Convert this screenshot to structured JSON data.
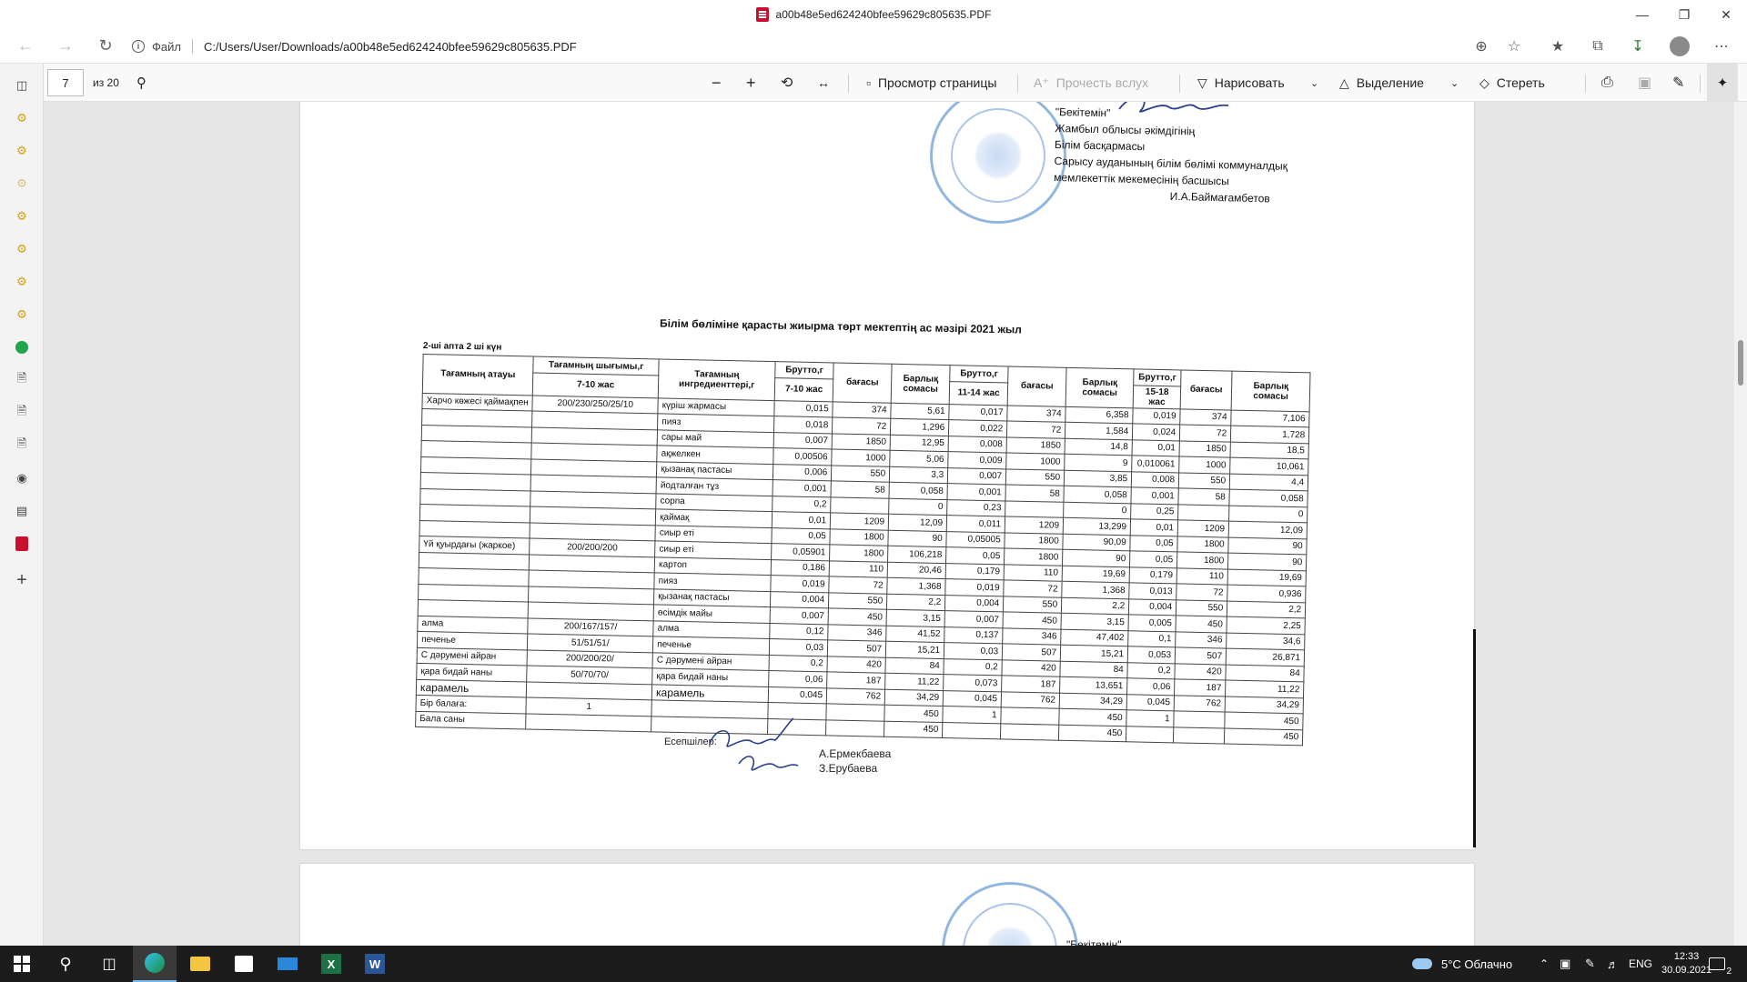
{
  "window": {
    "title": "a00b48e5ed624240bfee59629c805635.PDF"
  },
  "address": {
    "scheme_label": "Файл",
    "url": "C:/Users/User/Downloads/a00b48e5ed624240bfee59629c805635.PDF"
  },
  "pdf_toolbar": {
    "page_current": "7",
    "page_total": "из 20",
    "page_view": "Просмотр страницы",
    "read_aloud": "Прочесть вслух",
    "draw": "Нарисовать",
    "highlight": "Выделение",
    "erase": "Стереть"
  },
  "document": {
    "approval": {
      "heading": "\"Бекітемін\"",
      "line1": "Жамбыл облысы  әкімдігінің",
      "line2": "Білім басқармасы",
      "line3": "Сарысу ауданының білім бөлімі коммуналдық",
      "line4": "мемлекеттік мекемесінің басшысы",
      "signer": "И.А.Баймағамбетов"
    },
    "title": "Білім бөліміне қарасты жиырма төрт мектептің ас мәзірі 2021 жыл",
    "week": "2-ші апта 2 ші күн",
    "headers": {
      "food_name": "Тағамның атауы",
      "yield": "Тағамның шығымы,г",
      "ingredients": "Тағамның ингредиенттері,г",
      "brutto": "Брутто,г",
      "price": "бағасы",
      "total": "Барлық сомасы",
      "age1": "7-10 жас",
      "age2": "11-14 жас",
      "age3": "15-18 жас",
      "total_last": "Барлық сомасы"
    },
    "rows": [
      {
        "dish": "Харчо көжесі қаймақпен",
        "yield": "200/230/250/25/10",
        "ing": "күріш жармасы",
        "c": [
          "0,015",
          "374",
          "5,61",
          "0,017",
          "374",
          "6,358",
          "0,019",
          "374",
          "7,106"
        ]
      },
      {
        "dish": "",
        "yield": "",
        "ing": "пияз",
        "c": [
          "0,018",
          "72",
          "1,296",
          "0,022",
          "72",
          "1,584",
          "0,024",
          "72",
          "1,728"
        ]
      },
      {
        "dish": "",
        "yield": "",
        "ing": "сары май",
        "c": [
          "0,007",
          "1850",
          "12,95",
          "0,008",
          "1850",
          "14,8",
          "0,01",
          "1850",
          "18,5"
        ]
      },
      {
        "dish": "",
        "yield": "",
        "ing": "ақжелкен",
        "c": [
          "0,00506",
          "1000",
          "5,06",
          "0,009",
          "1000",
          "9",
          "0,010061",
          "1000",
          "10,061"
        ]
      },
      {
        "dish": "",
        "yield": "",
        "ing": "қызанақ пастасы",
        "c": [
          "0,006",
          "550",
          "3,3",
          "0,007",
          "550",
          "3,85",
          "0,008",
          "550",
          "4,4"
        ]
      },
      {
        "dish": "",
        "yield": "",
        "ing": "йодталған тұз",
        "c": [
          "0,001",
          "58",
          "0,058",
          "0,001",
          "58",
          "0,058",
          "0,001",
          "58",
          "0,058"
        ]
      },
      {
        "dish": "",
        "yield": "",
        "ing": "сорпа",
        "c": [
          "0,2",
          "",
          "0",
          "0,23",
          "",
          "0",
          "0,25",
          "",
          "0"
        ]
      },
      {
        "dish": "",
        "yield": "",
        "ing": "қаймақ",
        "c": [
          "0,01",
          "1209",
          "12,09",
          "0,011",
          "1209",
          "13,299",
          "0,01",
          "1209",
          "12,09"
        ]
      },
      {
        "dish": "",
        "yield": "",
        "ing": "сиыр еті",
        "c": [
          "0,05",
          "1800",
          "90",
          "0,05005",
          "1800",
          "90,09",
          "0,05",
          "1800",
          "90"
        ]
      },
      {
        "dish": "Үй қуырдағы (жаркое)",
        "yield": "200/200/200",
        "ing": "сиыр еті",
        "c": [
          "0,05901",
          "1800",
          "106,218",
          "0,05",
          "1800",
          "90",
          "0,05",
          "1800",
          "90"
        ]
      },
      {
        "dish": "",
        "yield": "",
        "ing": "картоп",
        "c": [
          "0,186",
          "110",
          "20,46",
          "0,179",
          "110",
          "19,69",
          "0,179",
          "110",
          "19,69"
        ]
      },
      {
        "dish": "",
        "yield": "",
        "ing": "пияз",
        "c": [
          "0,019",
          "72",
          "1,368",
          "0,019",
          "72",
          "1,368",
          "0,013",
          "72",
          "0,936"
        ]
      },
      {
        "dish": "",
        "yield": "",
        "ing": "қызанақ пастасы",
        "c": [
          "0,004",
          "550",
          "2,2",
          "0,004",
          "550",
          "2,2",
          "0,004",
          "550",
          "2,2"
        ]
      },
      {
        "dish": "",
        "yield": "",
        "ing": "өсімдік майы",
        "c": [
          "0,007",
          "450",
          "3,15",
          "0,007",
          "450",
          "3,15",
          "0,005",
          "450",
          "2,25"
        ]
      },
      {
        "dish": "алма",
        "yield": "200/167/157/",
        "ing": "алма",
        "c": [
          "0,12",
          "346",
          "41,52",
          "0,137",
          "346",
          "47,402",
          "0,1",
          "346",
          "34,6"
        ]
      },
      {
        "dish": "печенье",
        "yield": "51/51/51/",
        "ing": "печенье",
        "c": [
          "0,03",
          "507",
          "15,21",
          "0,03",
          "507",
          "15,21",
          "0,053",
          "507",
          "26,871"
        ]
      },
      {
        "dish": "С дәрумені айран",
        "yield": "200/200/20/",
        "ing": "С дәрумені айран",
        "c": [
          "0,2",
          "420",
          "84",
          "0,2",
          "420",
          "84",
          "0,2",
          "420",
          "84"
        ]
      },
      {
        "dish": "қара бидай наны",
        "yield": "50/70/70/",
        "ing": "қара бидай наны",
        "c": [
          "0,06",
          "187",
          "11,22",
          "0,073",
          "187",
          "13,651",
          "0,06",
          "187",
          "11,22"
        ]
      },
      {
        "dish": "карамель",
        "yield": "",
        "ing": "карамель",
        "c": [
          "0,045",
          "762",
          "34,29",
          "0,045",
          "762",
          "34,29",
          "0,045",
          "762",
          "34,29"
        ]
      },
      {
        "dish": "Бір балаға:",
        "yield": "1",
        "ing": "",
        "c": [
          "",
          "",
          "450",
          "1",
          "",
          "450",
          "1",
          "",
          "450"
        ]
      },
      {
        "dish": "Бала саны",
        "yield": "",
        "ing": "",
        "c": [
          "",
          "",
          "450",
          "",
          "",
          "450",
          "",
          "",
          "450"
        ]
      }
    ],
    "accountants_label": "Есепшілер:",
    "accountant1": "А.Ермекбаева",
    "accountant2": "З.Ерубаева",
    "next_page_heading": "\"Бекітемін\""
  },
  "taskbar": {
    "weather": "5°C  Облачно",
    "lang": "ENG",
    "time": "12:33",
    "date": "30.09.2021",
    "notif_count": "2"
  }
}
